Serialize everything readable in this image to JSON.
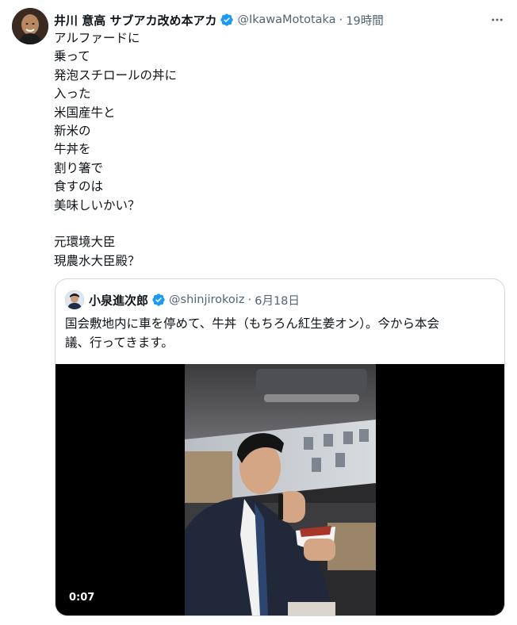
{
  "tweet": {
    "author_name": "井川 意高 サブアカ改め本アカ",
    "author_handle": "@IkawaMototaka",
    "separator": "·",
    "time": "19時間",
    "body_lines": [
      "アルファードに",
      "乗って",
      "発泡スチロールの丼に",
      "入った",
      "米国産牛と",
      "新米の",
      "牛丼を",
      "割り箸で",
      "食すのは",
      "美味しいかい？",
      "",
      "元環境大臣",
      "現農水大臣殿？"
    ]
  },
  "quoted": {
    "author_name": "小泉進次郎",
    "author_handle": "@shinjirokoiz",
    "separator": "·",
    "time": "6月18日",
    "text_line1": "国会敷地内に車を停めて、牛丼（もちろん紅生姜オン）。今から本会",
    "text_line2": "議、行ってきます。",
    "video_duration": "0:07"
  },
  "icons": {
    "verified": "verified-badge-icon",
    "more": "more-options-icon"
  },
  "colors": {
    "verified_blue": "#1d9bf0",
    "secondary_text": "#536471",
    "border": "#cfd9de"
  }
}
